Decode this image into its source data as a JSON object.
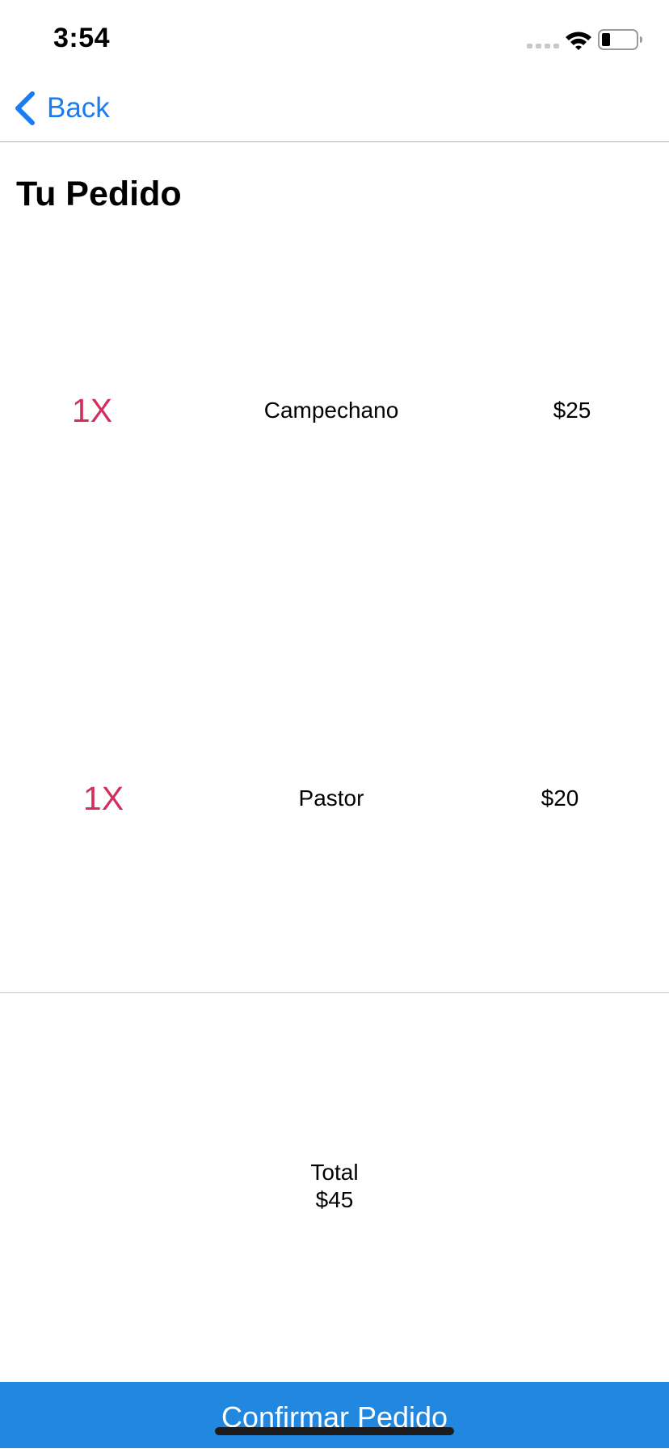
{
  "status_bar": {
    "time": "3:54"
  },
  "nav": {
    "back_label": "Back"
  },
  "page_title": "Tu Pedido",
  "order_items": [
    {
      "quantity": "1X",
      "name": "Campechano",
      "price": "$25"
    },
    {
      "quantity": "1X",
      "name": "Pastor",
      "price": "$20"
    }
  ],
  "total": {
    "label": "Total",
    "value": "$45"
  },
  "confirm_button": {
    "label": "Confirmar Pedido"
  },
  "colors": {
    "accent_blue": "#1a7cf2",
    "button_blue": "#2287de",
    "quantity_pink": "#d1305f"
  },
  "icons": {
    "back": "chevron-left-icon",
    "signal": "cellular-signal-icon",
    "wifi": "wifi-icon",
    "battery": "battery-icon"
  }
}
